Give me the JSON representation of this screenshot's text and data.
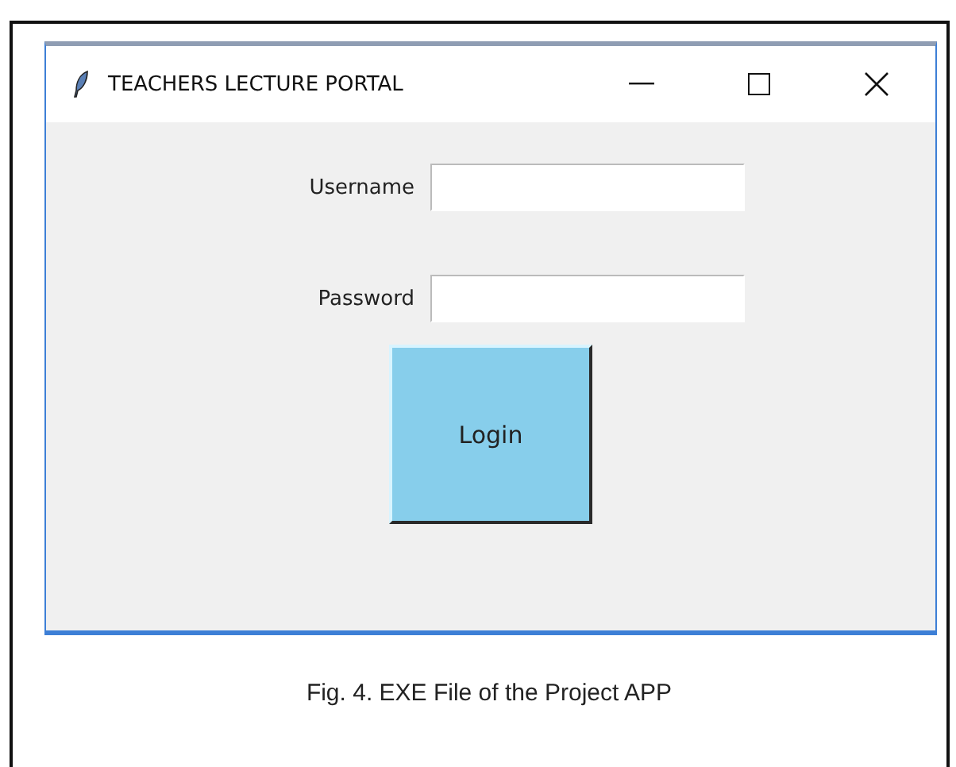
{
  "window": {
    "title": "TEACHERS LECTURE PORTAL"
  },
  "fields": [
    {
      "label": "Username"
    },
    {
      "label": "Password"
    }
  ],
  "button": "Login",
  "caption": "Fig. 4. EXE File of the Project APP"
}
